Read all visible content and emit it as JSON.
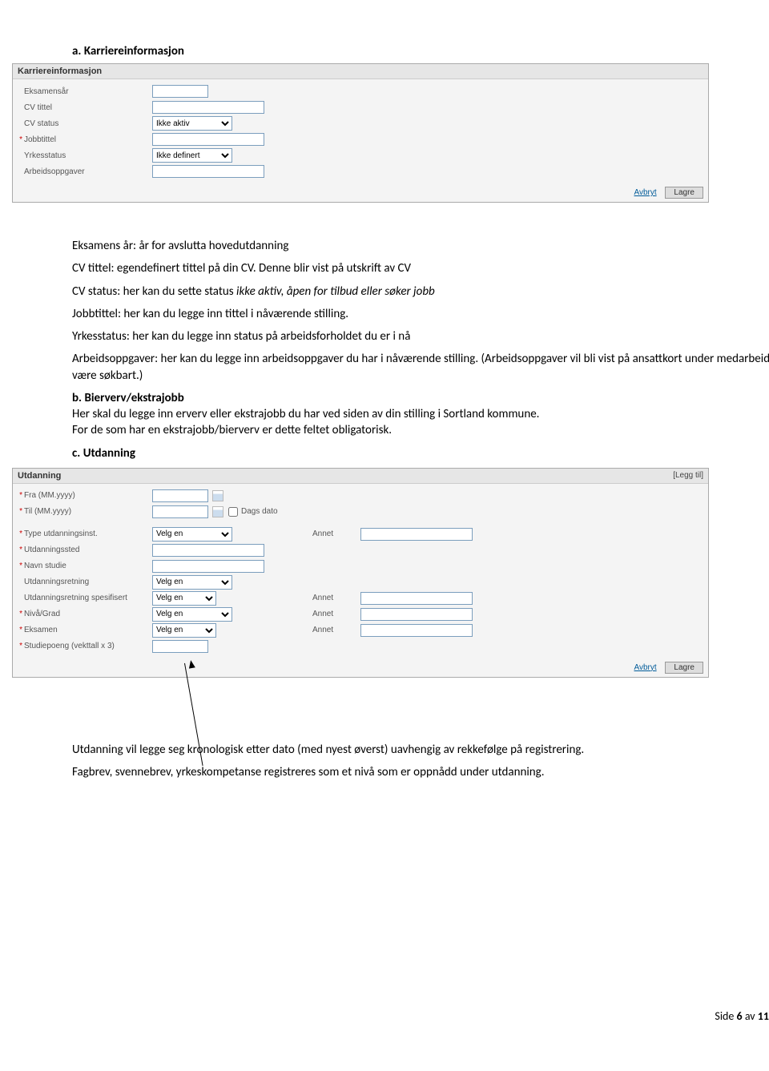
{
  "section_a": {
    "label": "a.",
    "title": "Karriereinformasjon"
  },
  "panel1": {
    "title": "Karriereinformasjon",
    "rows": {
      "eksamensar": {
        "label": "Eksamensår"
      },
      "cv_tittel": {
        "label": "CV tittel"
      },
      "cv_status": {
        "label": "CV status",
        "value": "Ikke aktiv"
      },
      "jobbtittel": {
        "label": "Jobbtittel"
      },
      "yrkesstatus": {
        "label": "Yrkesstatus",
        "value": "Ikke definert"
      },
      "arbeidsoppgaver": {
        "label": "Arbeidsoppgaver"
      }
    },
    "actions": {
      "avbryt": "Avbryt",
      "lagre": "Lagre"
    }
  },
  "body_a": {
    "l1": "Eksamens år: år for avslutta hovedutdanning",
    "l2": "CV tittel: egendefinert tittel på din CV. Denne blir vist på utskrift av CV",
    "l3a": "CV status: her kan du sette status ",
    "l3i": "ikke aktiv, åpen for tilbud eller søker jobb",
    "l4": "Jobbtittel: her kan du legge inn tittel i nåværende stilling.",
    "l5": "Yrkesstatus: her kan du legge inn status på arbeidsforholdet du er i nå",
    "l6": "Arbeidsoppgaver: her kan du legge inn arbeidsoppgaver du har i nåværende stilling. (Arbeidsoppgaver vil bli vist på ansattkort under medarbeidere, og vil der være søkbart.)"
  },
  "section_b": {
    "label": "b.",
    "title": "Bierverv/ekstrajobb",
    "p1": "Her skal du legge inn erverv eller ekstrajobb du har ved siden av din stilling i Sortland kommune.",
    "p2": "For de som har en ekstrajobb/bierverv er dette feltet obligatorisk."
  },
  "section_c": {
    "label": "c.",
    "title": "Utdanning"
  },
  "panel2": {
    "title": "Utdanning",
    "legg_til": "[Legg til]",
    "rows": {
      "fra": {
        "label": "Fra (MM.yyyy)"
      },
      "til": {
        "label": "Til (MM.yyyy)",
        "chk_label": "Dags dato"
      },
      "type_inst": {
        "label": "Type utdanningsinst.",
        "value": "Velg en",
        "annet": "Annet"
      },
      "utdannsted": {
        "label": "Utdanningssted"
      },
      "navn_studie": {
        "label": "Navn studie"
      },
      "utd_retning": {
        "label": "Utdanningsretning",
        "value": "Velg en"
      },
      "utd_retning_spes": {
        "label": "Utdanningsretning spesifisert",
        "value": "Velg en",
        "annet": "Annet"
      },
      "niva": {
        "label": "Nivå/Grad",
        "value": "Velg en",
        "annet": "Annet"
      },
      "eksamen": {
        "label": "Eksamen",
        "value": "Velg en",
        "annet": "Annet"
      },
      "studiepoeng": {
        "label": "Studiepoeng (vekttall x 3)"
      }
    },
    "actions": {
      "avbryt": "Avbryt",
      "lagre": "Lagre"
    }
  },
  "body_c": {
    "p1": "Utdanning vil legge seg kronologisk etter dato (med nyest øverst) uavhengig av rekkefølge på registrering.",
    "p2": "Fagbrev, svennebrev, yrkeskompetanse registreres som et nivå som er oppnådd under utdanning."
  },
  "footer": {
    "prefix": "Side ",
    "page": "6",
    "mid": " av ",
    "total": "11"
  }
}
